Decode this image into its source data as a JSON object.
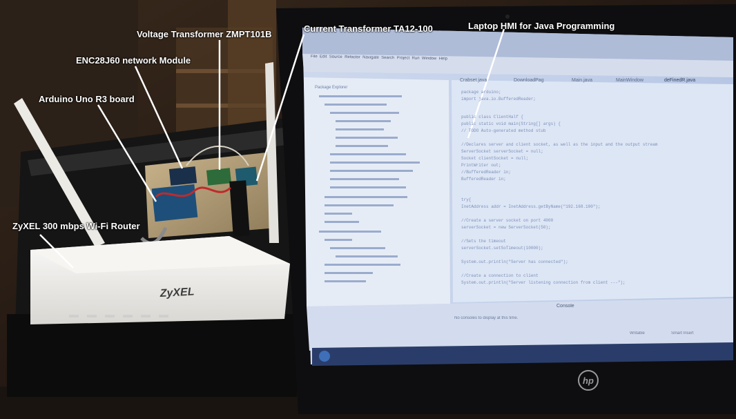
{
  "annotations": {
    "voltage_transformer": "Voltage Transformer ZMPT101B",
    "current_transformer": "Current Transformer  TA12-100",
    "laptop_hmi": "Laptop HMI for Java Programming",
    "network_module": "ENC28J60 network Module",
    "arduino_board": "Arduino Uno R3 board",
    "router": "ZyXEL 300 mbps Wi-Fi Router"
  },
  "router_brand": "ZyXEL",
  "laptop_brand": "hp",
  "ide": {
    "menu": [
      "File",
      "Edit",
      "Source",
      "Refactor",
      "Navigate",
      "Search",
      "Project",
      "Run",
      "Window",
      "Help"
    ],
    "explorer_title": "Package Explorer",
    "editor_tabs": [
      "Crabset.java",
      "DownloadPag",
      "Main.java",
      "MainWindow",
      "deFinedR.java"
    ],
    "code_lines": [
      "package arduino;",
      "import java.io.BufferedReader;",
      "",
      "public class ClientHalf {",
      "    public static void main(String[] args) {",
      "        // TODO Auto-generated method stub",
      "",
      "        //Declares server and client socket, as well as the input and the output stream",
      "        ServerSocket serverSocket = null;",
      "        Socket clientSocket = null;",
      "        PrintWriter out;",
      "        //BufferedReader in;",
      "        BufferedReader in;",
      "",
      "",
      "        try{",
      "            InetAddress addr = InetAddress.getByName(\"192.168.100\");",
      "",
      "            //Create a server socket on port 4000",
      "            serverSocket = new ServerSocket(50);",
      "",
      "            //Sets the timeout",
      "            serverSocket.setSoTimeout(10000);",
      "",
      "            System.out.println(\"Server has connected\");",
      "",
      "            //Create a connection to client",
      "            System.out.println(\"Server listening connection from client ---\");"
    ],
    "console_tab": "Console",
    "console_message": "No consoles to display at this time.",
    "status_items": [
      "Writable",
      "Smart Insert"
    ]
  }
}
